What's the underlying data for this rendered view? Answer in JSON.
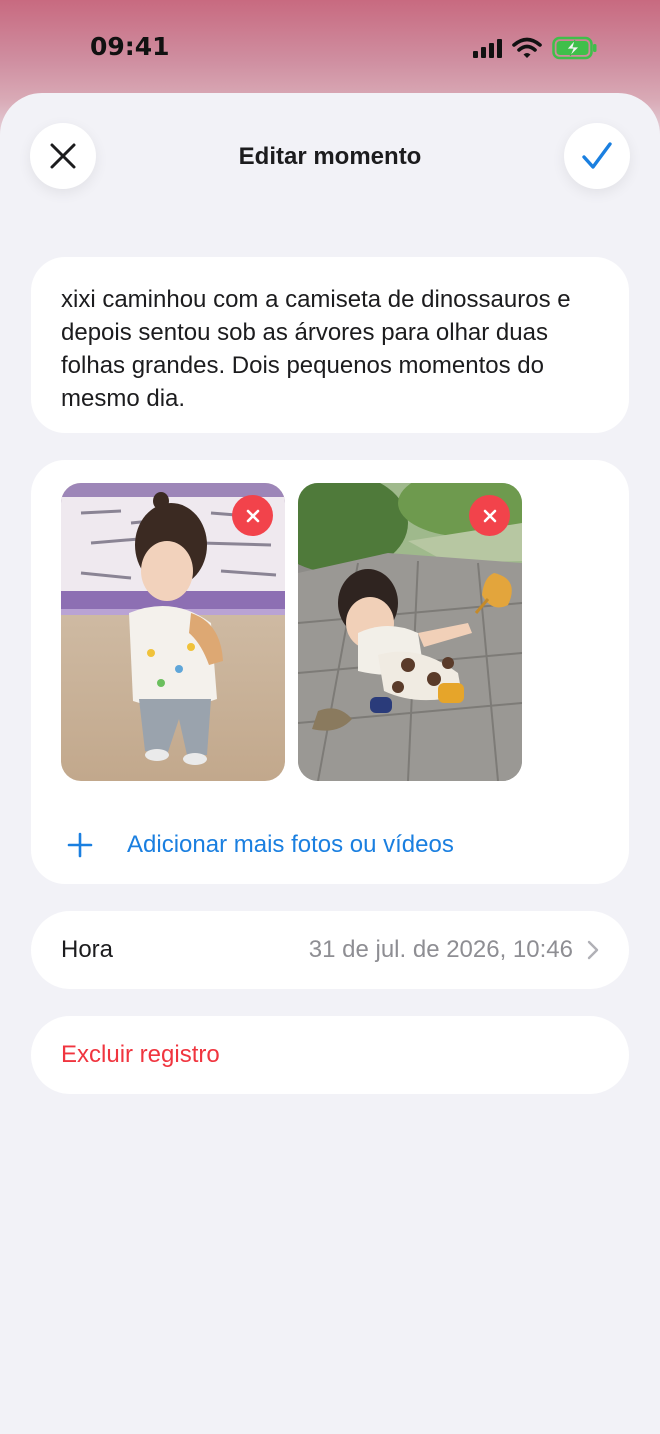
{
  "status_bar": {
    "time": "09:41"
  },
  "header": {
    "title": "Editar momento",
    "close_icon": "close-icon",
    "confirm_icon": "checkmark-icon"
  },
  "note": {
    "text": "xixi caminhou com a camiseta de dinossauros e depois sentou sob as árvores para olhar duas folhas grandes. Dois pequenos momentos do mesmo dia."
  },
  "media": {
    "items": [
      {
        "subject": "child-standing-in-mall",
        "remove_icon": "remove-icon"
      },
      {
        "subject": "child-sitting-with-leaf",
        "remove_icon": "remove-icon"
      }
    ],
    "add_label": "Adicionar mais fotos ou vídeos"
  },
  "time_row": {
    "label": "Hora",
    "value": "31 de jul. de 2026, 10:46"
  },
  "delete_label": "Excluir registro",
  "colors": {
    "accent": "#1a7fe0",
    "destructive": "#f0353f",
    "remove_badge": "#f2434b",
    "sheet_bg": "#f2f2f7"
  }
}
